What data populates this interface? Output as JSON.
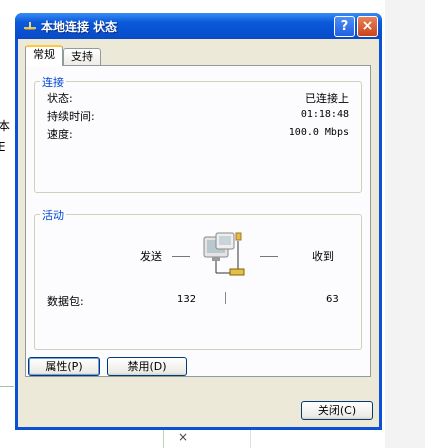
{
  "background": {
    "left_text_1": "本",
    "left_text_2": "E",
    "x_glyph": "×"
  },
  "window": {
    "title": "本地连接 状态",
    "help_glyph": "?",
    "close_glyph": "×",
    "icon": "network-connection-icon"
  },
  "tabs": [
    {
      "label": "常规"
    },
    {
      "label": "支持"
    }
  ],
  "connection": {
    "group_label": "连接",
    "status_label": "状态:",
    "status_value": "已连接上",
    "duration_label": "持续时间:",
    "duration_value": "01:18:48",
    "speed_label": "速度:",
    "speed_value": "100.0 Mbps"
  },
  "activity": {
    "group_label": "活动",
    "sent_label": "发送",
    "received_label": "收到",
    "packets_label": "数据包:",
    "packets_sent": "132",
    "packets_received": "63"
  },
  "buttons": {
    "properties": "属性(P)",
    "disable": "禁用(D)",
    "close": "关闭(C)"
  }
}
